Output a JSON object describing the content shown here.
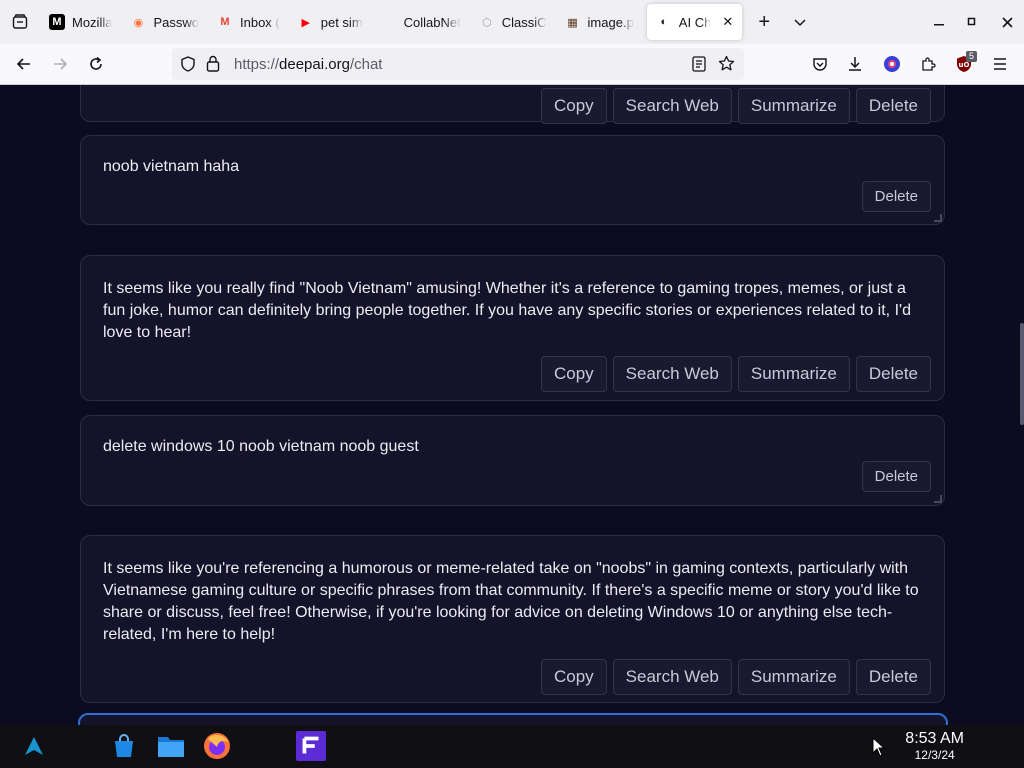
{
  "browser": {
    "tabs": [
      {
        "title": "Mozilla",
        "favicon": "M",
        "color": "#000000",
        "icon": "mozilla-icon"
      },
      {
        "title": "Passwo",
        "favicon": "◉",
        "color": "#ff7139",
        "icon": "firefox-icon"
      },
      {
        "title": "Inbox (",
        "favicon": "M",
        "color": "#ea4335",
        "icon": "gmail-icon"
      },
      {
        "title": "pet sim",
        "favicon": "▶",
        "color": "#ff0000",
        "icon": "youtube-icon"
      },
      {
        "title": "CollabNet",
        "favicon": "",
        "color": "#f0f0f4",
        "icon": "blank-icon"
      },
      {
        "title": "ClassiC",
        "favicon": "⬡",
        "color": "#9e9ea8",
        "icon": "hexagon-icon"
      },
      {
        "title": "image.p",
        "favicon": "▦",
        "color": "#5a3a1a",
        "icon": "image-icon"
      },
      {
        "title": "AI Ch",
        "favicon": "◐",
        "color": "#15141a",
        "icon": "deepai-icon",
        "active": true
      }
    ],
    "url_scheme": "https://",
    "url_host": "deepai.org",
    "url_path": "/chat",
    "extension_badge": "5"
  },
  "chat": {
    "top_actions": [
      "Copy",
      "Search Web",
      "Summarize",
      "Delete"
    ],
    "messages": [
      {
        "role": "user",
        "text": "noob vietnam haha",
        "actions": [
          "Delete"
        ]
      },
      {
        "role": "assistant",
        "text": "It seems like you really find \"Noob Vietnam\" amusing! Whether it's a reference to gaming tropes, memes, or just a fun joke, humor can definitely bring people together. If you have any specific stories or experiences related to it, I'd love to hear!",
        "actions": [
          "Copy",
          "Search Web",
          "Summarize",
          "Delete"
        ]
      },
      {
        "role": "user",
        "text": "delete windows 10 noob vietnam noob guest",
        "actions": [
          "Delete"
        ]
      },
      {
        "role": "assistant",
        "text": "It seems like you're referencing a humorous or meme-related take on \"noobs\" in gaming contexts, particularly with Vietnamese gaming culture or specific phrases from that community. If there's a specific meme or story you'd like to share or discuss, feel free! Otherwise, if you're looking for advice on deleting Windows 10 or anything else tech-related, I'm here to help!",
        "actions": [
          "Copy",
          "Search Web",
          "Summarize",
          "Delete"
        ]
      }
    ]
  },
  "taskbar": {
    "time": "8:53 AM",
    "date": "12/3/24"
  }
}
